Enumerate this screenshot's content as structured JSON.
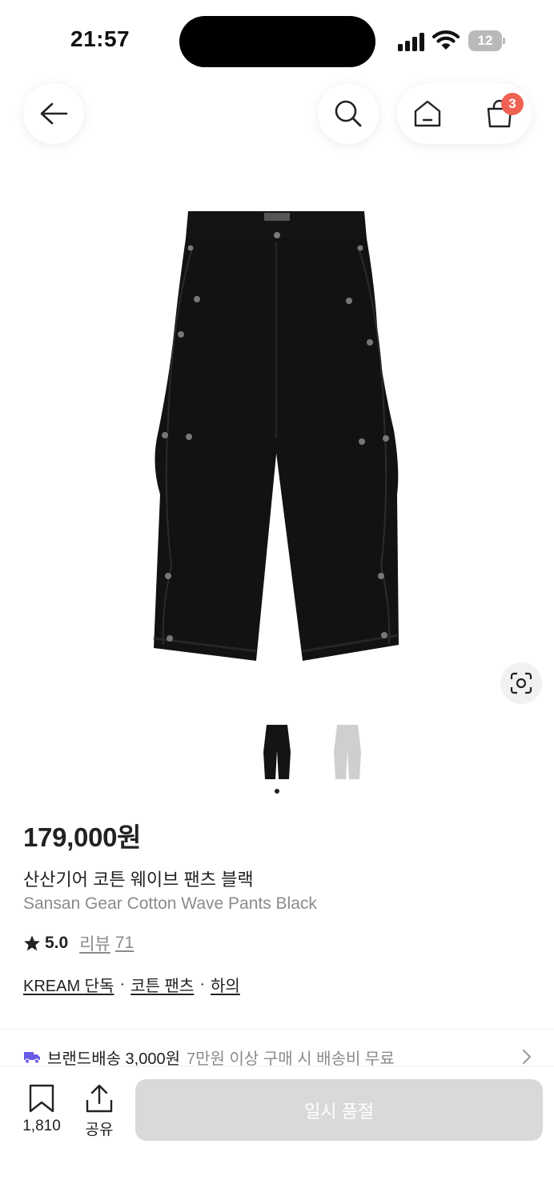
{
  "status_bar": {
    "time": "21:57",
    "battery": "12",
    "icons": [
      "signal-icon",
      "wifi-icon",
      "battery-icon"
    ]
  },
  "header": {
    "icons": [
      "back-arrow-icon",
      "search-icon",
      "home-icon",
      "shopping-bag-icon"
    ],
    "cart_badge": "3"
  },
  "gallery": {
    "image": "black-cargo-pants",
    "thumbnails": [
      "black-variant",
      "gray-variant"
    ],
    "active_index": 0
  },
  "product": {
    "price": "179,000원",
    "name_ko": "산산기어 코튼 웨이브 팬츠 블랙",
    "name_en": "Sansan Gear Cotton Wave Pants Black",
    "rating": "5.0",
    "review_label": "리뷰",
    "review_count": "71",
    "tags": [
      "KREAM 단독",
      "코튼 팬츠",
      "하의"
    ],
    "tag_separator": "·"
  },
  "shipping": {
    "label": "브랜드배송 3,000원",
    "description": "7만원 이상 구매 시 배송비 무료"
  },
  "bottom_bar": {
    "wish_count": "1,810",
    "share_label": "공유",
    "primary_button": "일시 품절"
  },
  "colors": {
    "badge": "#ef6253",
    "disabled_button": "#d9d9d9",
    "truck": "#6b5ce7",
    "muted_text": "#8b8b8b"
  }
}
